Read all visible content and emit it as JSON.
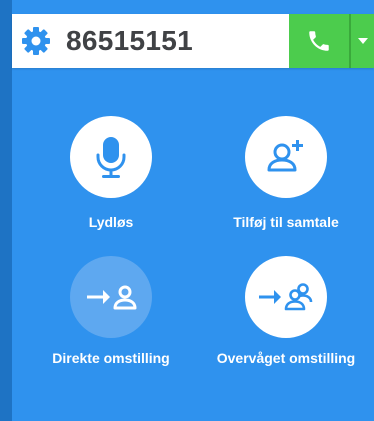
{
  "phone_input": {
    "number": "86515151"
  },
  "icons": {
    "settings": "gear-icon",
    "call": "phone-icon",
    "dropdown": "caret-down-icon"
  },
  "actions": [
    {
      "label": "Lydløs",
      "icon": "microphone-icon",
      "state": "active"
    },
    {
      "label": "Tilføj til samtale",
      "icon": "add-user-icon",
      "state": "active"
    },
    {
      "label": "Direkte omstilling",
      "icon": "transfer-user-icon",
      "state": "disabled"
    },
    {
      "label": "Overvåget omstilling",
      "icon": "transfer-users-icon",
      "state": "active"
    }
  ],
  "colors": {
    "background": "#2f92ee",
    "accent_blue": "#2f92ee",
    "call_green": "#4ccc4d",
    "text_dark": "#404245",
    "white": "#ffffff"
  }
}
